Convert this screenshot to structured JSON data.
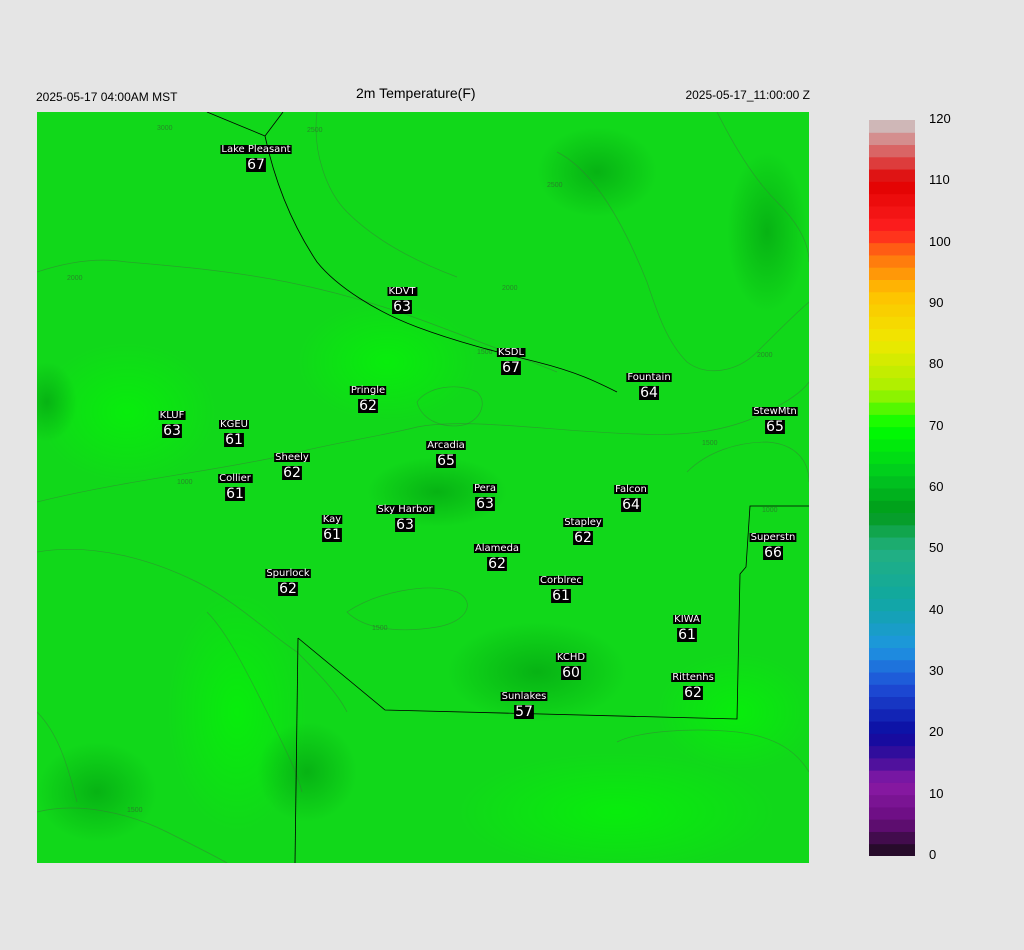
{
  "header": {
    "valid_local": "2025-05-17 04:00AM MST",
    "title": "2m Temperature(F)",
    "valid_utc": "2025-05-17_11:00:00 Z"
  },
  "colorbar": {
    "ticks": [
      "120",
      "110",
      "100",
      "90",
      "80",
      "70",
      "60",
      "50",
      "40",
      "30",
      "20",
      "10",
      "0"
    ],
    "range": [
      0,
      120
    ],
    "stops": [
      {
        "v": 0,
        "c": "#1a0a1a"
      },
      {
        "v": 6,
        "c": "#6a0d80"
      },
      {
        "v": 12,
        "c": "#8a1aa6"
      },
      {
        "v": 16,
        "c": "#3c0e9a"
      },
      {
        "v": 20,
        "c": "#0a0aa0"
      },
      {
        "v": 28,
        "c": "#1e50d8"
      },
      {
        "v": 34,
        "c": "#1e96e0"
      },
      {
        "v": 42,
        "c": "#10a8a0"
      },
      {
        "v": 50,
        "c": "#22b080"
      },
      {
        "v": 56,
        "c": "#009a1a"
      },
      {
        "v": 62,
        "c": "#00c820"
      },
      {
        "v": 70,
        "c": "#00ff00"
      },
      {
        "v": 76,
        "c": "#a8f000"
      },
      {
        "v": 84,
        "c": "#f0e800"
      },
      {
        "v": 92,
        "c": "#ffc000"
      },
      {
        "v": 98,
        "c": "#ff7010"
      },
      {
        "v": 102,
        "c": "#ff2020"
      },
      {
        "v": 110,
        "c": "#e00000"
      },
      {
        "v": 114,
        "c": "#dc5050"
      },
      {
        "v": 120,
        "c": "#cccccc"
      }
    ]
  },
  "contour_labels": [
    "1000",
    "1500",
    "2000",
    "2500",
    "3000"
  ],
  "stations": [
    {
      "name": "Lake Pleasant",
      "value": "67"
    },
    {
      "name": "KDVT",
      "value": "63"
    },
    {
      "name": "KSDL",
      "value": "67"
    },
    {
      "name": "Fountain",
      "value": "64"
    },
    {
      "name": "StewMtn",
      "value": "65"
    },
    {
      "name": "Pringle",
      "value": "62"
    },
    {
      "name": "KLUF",
      "value": "63"
    },
    {
      "name": "KGEU",
      "value": "61"
    },
    {
      "name": "Arcadia",
      "value": "65"
    },
    {
      "name": "Sheely",
      "value": "62"
    },
    {
      "name": "Collier",
      "value": "61"
    },
    {
      "name": "Pera",
      "value": "63"
    },
    {
      "name": "Falcon",
      "value": "64"
    },
    {
      "name": "Kay",
      "value": "61"
    },
    {
      "name": "Sky Harbor",
      "value": "63"
    },
    {
      "name": "Stapley",
      "value": "62"
    },
    {
      "name": "Superstn",
      "value": "66"
    },
    {
      "name": "Alameda",
      "value": "62"
    },
    {
      "name": "Spurlock",
      "value": "62"
    },
    {
      "name": "Corblrec",
      "value": "61"
    },
    {
      "name": "KIWA",
      "value": "61"
    },
    {
      "name": "KCHD",
      "value": "60"
    },
    {
      "name": "Rittenhs",
      "value": "62"
    },
    {
      "name": "Sunlakes",
      "value": "57"
    }
  ]
}
